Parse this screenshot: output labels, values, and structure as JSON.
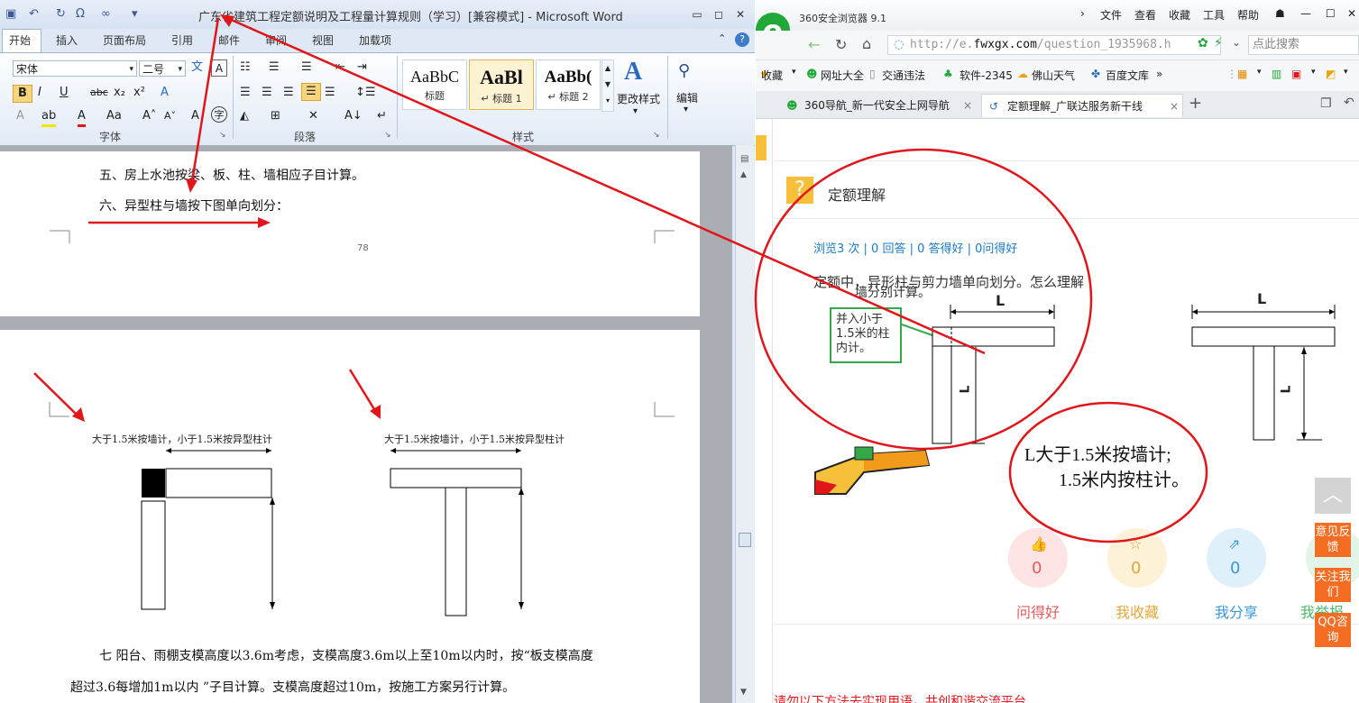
{
  "word": {
    "title": "广东省建筑工程定额说明及工程量计算规则（学习）[兼容模式] - Microsoft Word",
    "tabs": [
      "开始",
      "插入",
      "页面布局",
      "引用",
      "邮件",
      "审阅",
      "视图",
      "加载项"
    ],
    "font_name": "宋体",
    "font_size": "二号",
    "groups": {
      "font": "字体",
      "paragraph": "段落",
      "styles": "样式"
    },
    "styles": [
      {
        "sample": "AaBbC",
        "name": "标题"
      },
      {
        "sample": "AaBl",
        "name": "↵ 标题 1"
      },
      {
        "sample": "AaBb(",
        "name": "↵ 标题 2"
      }
    ],
    "change_styles": "更改样式",
    "edit": "编辑",
    "doc": {
      "line5": "五、房上水池按梁、板、柱、墙相应子目计算。",
      "line6": "六、异型柱与墙按下图单向划分：",
      "page_number": "78",
      "fig_caption_left": "大于1.5米按墙计，小于1.5米按异型柱计",
      "fig_caption_right": "大于1.5米按墙计，小于1.5米按异型柱计",
      "line7a": "七  阳台、雨棚支模高度以3.6m考虑，支模高度3.6m以上至10m以内时，按“板支模高度",
      "line7b": "超过3.6每增加1m以内 ”子目计算。支模高度超过10m，按施工方案另行计算。"
    }
  },
  "browser": {
    "title": "360安全浏览器 9.1",
    "menu": [
      "文件",
      "查看",
      "收藏",
      "工具",
      "帮助"
    ],
    "url_prefix": "http://e.",
    "url_domain": "fwxgx.com",
    "url_path": "/question_1935968.h",
    "search_placeholder": "点此搜索",
    "favorites": [
      "收藏",
      "网址大全",
      "交通违法",
      "软件-2345",
      "佛山天气",
      "百度文库"
    ],
    "tabs": [
      {
        "label": "360导航_新一代安全上网导航"
      },
      {
        "label": "定额理解_广联达服务新干线"
      }
    ],
    "question_header": "定额理解",
    "stats": "浏览3 次 | 0 回答 | 0 答得好 | 0问得好",
    "question_text": "定额中，异形柱与剪力墙单向划分。怎么理解",
    "img_partial_text": "墙分别计算。",
    "img_green_box": "并入小于1.5米的柱内计。",
    "img_L_top_left": "L",
    "img_L_side_left": "L",
    "img_L_top_right": "L",
    "img_L_side_right": "L",
    "img_note_line1": "L大于1.5米按墙计;",
    "img_note_line2": "1.5米内按柱计。",
    "actions": [
      {
        "count": "0",
        "label": "问得好"
      },
      {
        "count": "0",
        "label": "我收藏"
      },
      {
        "count": "0",
        "label": "我分享"
      },
      {
        "count": "",
        "label": "我举报"
      }
    ],
    "side": [
      "意见反馈",
      "关注我们",
      "QQ咨询"
    ],
    "bottom_text": "请勿以下方法去实现用语，共创和谐交流平台"
  },
  "colors": {
    "annotation_red": "#e0161b",
    "side_orange": "#f46d22",
    "link_blue": "#1b7bc4"
  }
}
